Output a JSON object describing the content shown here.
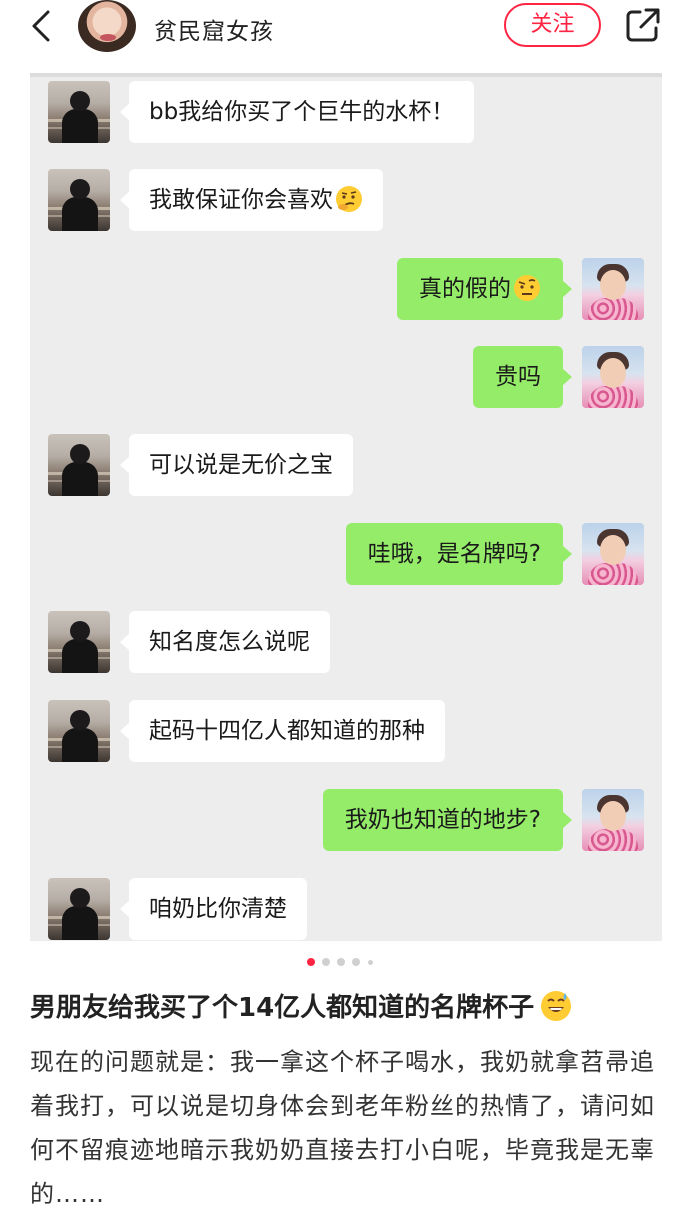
{
  "header": {
    "author_name": "贫民窟女孩",
    "follow_label": "关注",
    "back_icon": "chevron-left-icon",
    "share_icon": "share-icon"
  },
  "chat": {
    "messages": [
      {
        "side": "left",
        "text": "bb我给你买了个巨牛的水杯！",
        "emoji": ""
      },
      {
        "side": "left",
        "text": "我敢保证你会喜欢",
        "emoji": "thinking-face-emoji"
      },
      {
        "side": "right",
        "text": "真的假的",
        "emoji": "raised-eyebrow-emoji"
      },
      {
        "side": "right",
        "text": "贵吗",
        "emoji": ""
      },
      {
        "side": "left",
        "text": "可以说是无价之宝",
        "emoji": ""
      },
      {
        "side": "right",
        "text": "哇哦，是名牌吗?",
        "emoji": ""
      },
      {
        "side": "left",
        "text": "知名度怎么说呢",
        "emoji": ""
      },
      {
        "side": "left",
        "text": "起码十四亿人都知道的那种",
        "emoji": ""
      },
      {
        "side": "right",
        "text": "我奶也知道的地步?",
        "emoji": ""
      },
      {
        "side": "left",
        "text": "咱奶比你清楚",
        "emoji": ""
      }
    ]
  },
  "pager": {
    "count": 5,
    "active": 0
  },
  "post": {
    "title": "男朋友给我买了个14亿人都知道的名牌杯子",
    "title_emoji": "grinning-sweat-emoji",
    "body": "现在的问题就是：我一拿这个杯子喝水，我奶就拿苕帚追着我打，可以说是切身体会到老年粉丝的热情了，请问如何不留痕迹地暗示我奶奶直接去打小白呢，毕竟我是无辜的……"
  },
  "colors": {
    "accent": "#ff2442",
    "chat_background": "#ededed",
    "bubble_self": "#95ec69",
    "bubble_other": "#ffffff"
  }
}
